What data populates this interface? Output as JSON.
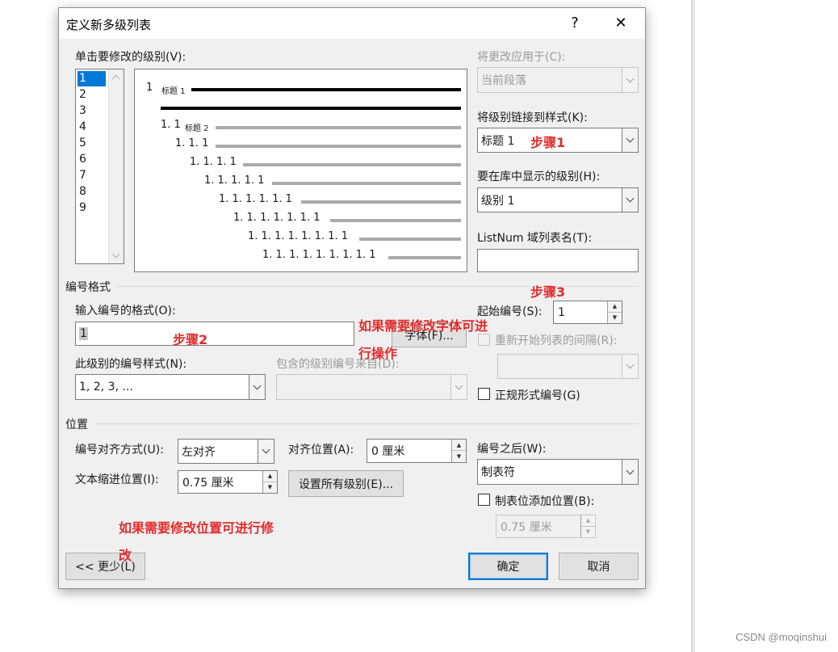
{
  "dialog": {
    "title": "定义新多级列表",
    "help": "?",
    "close": "✕"
  },
  "level_section": {
    "label": "单击要修改的级别(V):",
    "levels": [
      "1",
      "2",
      "3",
      "4",
      "5",
      "6",
      "7",
      "8",
      "9"
    ],
    "selected": "1"
  },
  "preview": {
    "rows": [
      {
        "num": "1",
        "text": "标题 1"
      },
      {
        "num": "1. 1",
        "text": "标题 2"
      },
      {
        "num": "1. 1. 1"
      },
      {
        "num": "1. 1. 1. 1"
      },
      {
        "num": "1. 1. 1. 1. 1"
      },
      {
        "num": "1. 1. 1. 1. 1. 1"
      },
      {
        "num": "1. 1. 1. 1. 1. 1. 1"
      },
      {
        "num": "1. 1. 1. 1. 1. 1. 1. 1"
      },
      {
        "num": "1. 1. 1. 1. 1. 1. 1. 1. 1"
      }
    ]
  },
  "right_panel": {
    "apply_to_label": "将更改应用于(C):",
    "apply_to_value": "当前段落",
    "link_style_label": "将级别链接到样式(K):",
    "link_style_value": "标题 1",
    "gallery_level_label": "要在库中显示的级别(H):",
    "gallery_level_value": "级别 1",
    "listnum_label": "ListNum 域列表名(T):",
    "listnum_value": ""
  },
  "number_format": {
    "section": "编号格式",
    "format_label": "输入编号的格式(O):",
    "format_value": "1",
    "font_button": "字体(F)...",
    "style_label": "此级别的编号样式(N):",
    "style_value": "1, 2, 3, ...",
    "include_label": "包含的级别编号来自(D):",
    "include_value": "",
    "start_at_label": "起始编号(S):",
    "start_at_value": "1",
    "restart_label": "重新开始列表的间隔(R):",
    "restart_value": "",
    "legal_label": "正规形式编号(G)"
  },
  "position": {
    "section": "位置",
    "align_label": "编号对齐方式(U):",
    "align_value": "左对齐",
    "align_at_label": "对齐位置(A):",
    "align_at_value": "0 厘米",
    "indent_label": "文本缩进位置(I):",
    "indent_value": "0.75 厘米",
    "set_all_button": "设置所有级别(E)...",
    "follow_label": "编号之后(W):",
    "follow_value": "制表符",
    "tab_stop_label": "制表位添加位置(B):",
    "tab_stop_value": "0.75 厘米"
  },
  "footer": {
    "less_button": "<< 更少(L)",
    "ok_button": "确定",
    "cancel_button": "取消"
  },
  "annotations": {
    "step1": "步骤1",
    "step2": "步骤2",
    "step3": "步骤3",
    "font_note_line1": "如果需要修改字体可进",
    "font_note_line2": "行操作",
    "position_note_line1": "如果需要修改位置可进行修",
    "position_note_line2": "改"
  },
  "watermark": "CSDN @moqinshui",
  "colors": {
    "dialog_bg": "#f0f0f0",
    "selection": "#0078d7",
    "annotation": "#e02d2d"
  }
}
